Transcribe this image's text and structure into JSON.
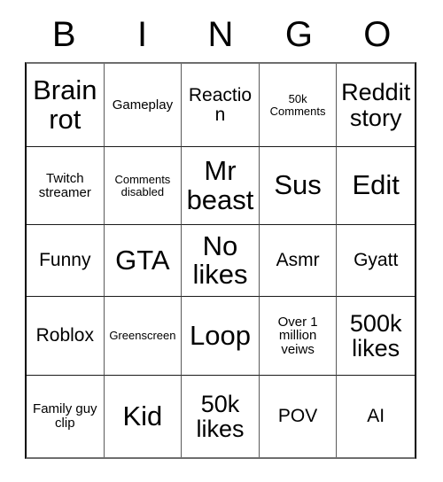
{
  "card": {
    "title": "BINGO",
    "header_letters": [
      "B",
      "I",
      "N",
      "G",
      "O"
    ],
    "rows": [
      [
        {
          "text": "Brain rot",
          "size": "xl"
        },
        {
          "text": "Gameplay",
          "size": "sm"
        },
        {
          "text": "Reaction",
          "size": "md"
        },
        {
          "text": "50k Comments",
          "size": "xs"
        },
        {
          "text": "Reddit story",
          "size": "lg"
        }
      ],
      [
        {
          "text": "Twitch streamer",
          "size": "sm"
        },
        {
          "text": "Comments disabled",
          "size": "xs"
        },
        {
          "text": "Mr beast",
          "size": "xl"
        },
        {
          "text": "Sus",
          "size": "xl"
        },
        {
          "text": "Edit",
          "size": "xl"
        }
      ],
      [
        {
          "text": "Funny",
          "size": "md"
        },
        {
          "text": "GTA",
          "size": "xl"
        },
        {
          "text": "No likes",
          "size": "xl"
        },
        {
          "text": "Asmr",
          "size": "md"
        },
        {
          "text": "Gyatt",
          "size": "md"
        }
      ],
      [
        {
          "text": "Roblox",
          "size": "md"
        },
        {
          "text": "Greenscreen",
          "size": "xs"
        },
        {
          "text": "Loop",
          "size": "xl"
        },
        {
          "text": "Over 1 million veiws",
          "size": "sm"
        },
        {
          "text": "500k likes",
          "size": "lg"
        }
      ],
      [
        {
          "text": "Family guy clip",
          "size": "sm"
        },
        {
          "text": "Kid",
          "size": "xl"
        },
        {
          "text": "50k likes",
          "size": "lg"
        },
        {
          "text": "POV",
          "size": "md"
        },
        {
          "text": "AI",
          "size": "md"
        }
      ]
    ]
  },
  "colors": {
    "background": "#ffffff",
    "text": "#000000",
    "grid_line": "#5a5a5a",
    "outer_border": "#000000"
  }
}
